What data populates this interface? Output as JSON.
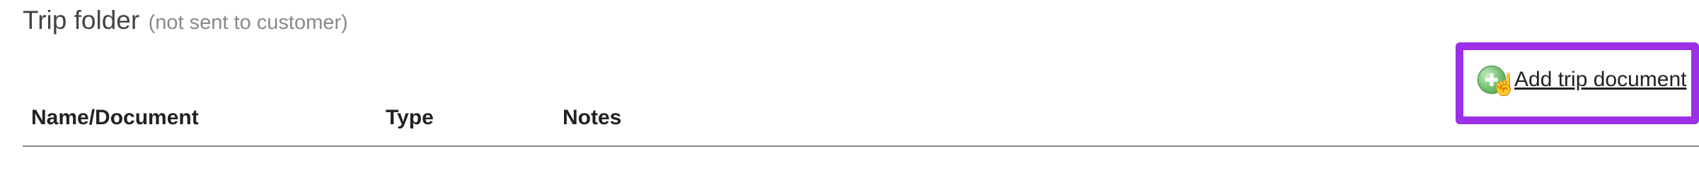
{
  "section": {
    "title": "Trip folder",
    "subtitle": "(not sent to customer)"
  },
  "actions": {
    "add_document_label": "Add trip document",
    "add_document_icon": "add-circle-icon",
    "highlight_color": "#9b30e6"
  },
  "table": {
    "columns": [
      "Name/Document",
      "Type",
      "Notes"
    ]
  }
}
